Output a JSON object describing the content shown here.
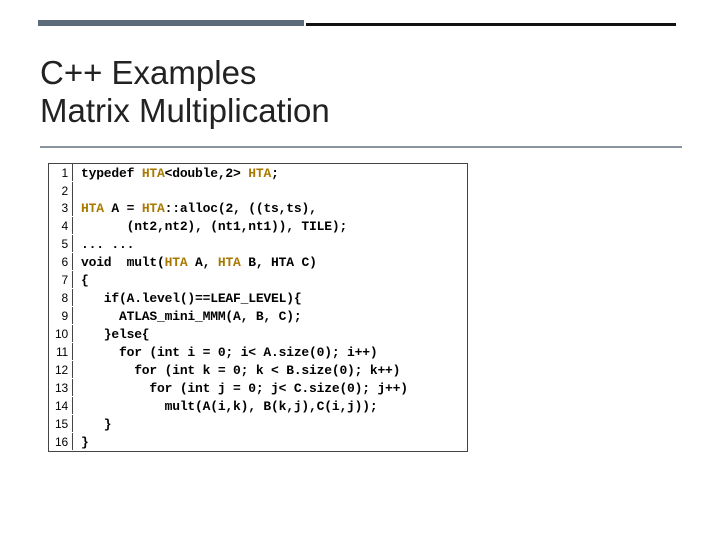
{
  "title_line1": "C++ Examples",
  "title_line2": "Matrix Multiplication",
  "code": {
    "lines": [
      {
        "n": "1",
        "pre": "typedef ",
        "hta": "HTA",
        "mid": "<double,2> ",
        "hta2": "HTA",
        "post": ";"
      },
      {
        "n": "2",
        "pre": "",
        "hta": "",
        "mid": "",
        "hta2": "",
        "post": ""
      },
      {
        "n": "3",
        "pre": "",
        "hta": "HTA",
        "mid": " A = ",
        "hta2": "HTA",
        "post": "::alloc(2, ((ts,ts),"
      },
      {
        "n": "4",
        "pre": "      (nt2,nt2), (nt1,nt1)), TILE);",
        "hta": "",
        "mid": "",
        "hta2": "",
        "post": ""
      },
      {
        "n": "5",
        "pre": "... ...",
        "hta": "",
        "mid": "",
        "hta2": "",
        "post": ""
      },
      {
        "n": "6",
        "pre": "void  mult(",
        "hta": "HTA",
        "mid": " A, ",
        "hta2": "HTA",
        "post": " B, HTA C)"
      },
      {
        "n": "7",
        "pre": "{",
        "hta": "",
        "mid": "",
        "hta2": "",
        "post": ""
      },
      {
        "n": "8",
        "pre": "   if(A.level()==LEAF_LEVEL){",
        "hta": "",
        "mid": "",
        "hta2": "",
        "post": ""
      },
      {
        "n": "9",
        "pre": "     ATLAS_mini_MMM(A, B, C);",
        "hta": "",
        "mid": "",
        "hta2": "",
        "post": ""
      },
      {
        "n": "10",
        "pre": "   }else{",
        "hta": "",
        "mid": "",
        "hta2": "",
        "post": ""
      },
      {
        "n": "11",
        "pre": "     for (int i = 0; i< A.size(0); i++)",
        "hta": "",
        "mid": "",
        "hta2": "",
        "post": ""
      },
      {
        "n": "12",
        "pre": "       for (int k = 0; k < B.size(0); k++)",
        "hta": "",
        "mid": "",
        "hta2": "",
        "post": ""
      },
      {
        "n": "13",
        "pre": "         for (int j = 0; j< C.size(0); j++)",
        "hta": "",
        "mid": "",
        "hta2": "",
        "post": ""
      },
      {
        "n": "14",
        "pre": "           mult(A(i,k), B(k,j),C(i,j));",
        "hta": "",
        "mid": "",
        "hta2": "",
        "post": ""
      },
      {
        "n": "15",
        "pre": "   }",
        "hta": "",
        "mid": "",
        "hta2": "",
        "post": ""
      },
      {
        "n": "16",
        "pre": "}",
        "hta": "",
        "mid": "",
        "hta2": "",
        "post": ""
      }
    ]
  }
}
